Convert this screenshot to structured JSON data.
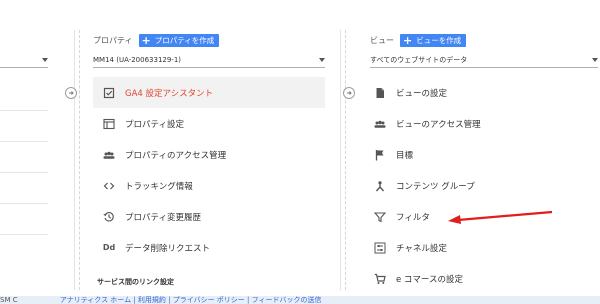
{
  "property": {
    "heading": "プロパティ",
    "create_label": "プロパティを作成",
    "selected": "MM14 (UA-200633129-1)",
    "items": [
      {
        "label": "GA4 設定アシスタント",
        "icon": "checklist-icon",
        "active": true
      },
      {
        "label": "プロパティ設定",
        "icon": "window-icon"
      },
      {
        "label": "プロパティのアクセス管理",
        "icon": "people-icon"
      },
      {
        "label": "トラッキング情報",
        "icon": "code-icon"
      },
      {
        "label": "プロパティ変更履歴",
        "icon": "history-icon"
      },
      {
        "label": "データ削除リクエスト",
        "icon": "dd-icon",
        "icon_text": "Dd"
      }
    ],
    "section_title": "サービス間のリンク設定"
  },
  "view": {
    "heading": "ビュー",
    "create_label": "ビューを作成",
    "selected": "すべてのウェブサイトのデータ",
    "items": [
      {
        "label": "ビューの設定",
        "icon": "document-icon"
      },
      {
        "label": "ビューのアクセス管理",
        "icon": "people-icon"
      },
      {
        "label": "目標",
        "icon": "flag-icon"
      },
      {
        "label": "コンテンツ グループ",
        "icon": "content-group-icon"
      },
      {
        "label": "フィルタ",
        "icon": "filter-icon"
      },
      {
        "label": "チャネル設定",
        "icon": "channel-settings-icon"
      },
      {
        "label": "e コマースの設定",
        "icon": "cart-icon"
      }
    ]
  },
  "footer": {
    "prefix": "SM C",
    "link_text": "アナリティクス ホーム | 利用規約 | プライバシー ポリシー | フィードバックの送信"
  },
  "colors": {
    "accent": "#4285f4",
    "active_text": "#e2442f",
    "annotation_arrow": "#e01e1e"
  }
}
